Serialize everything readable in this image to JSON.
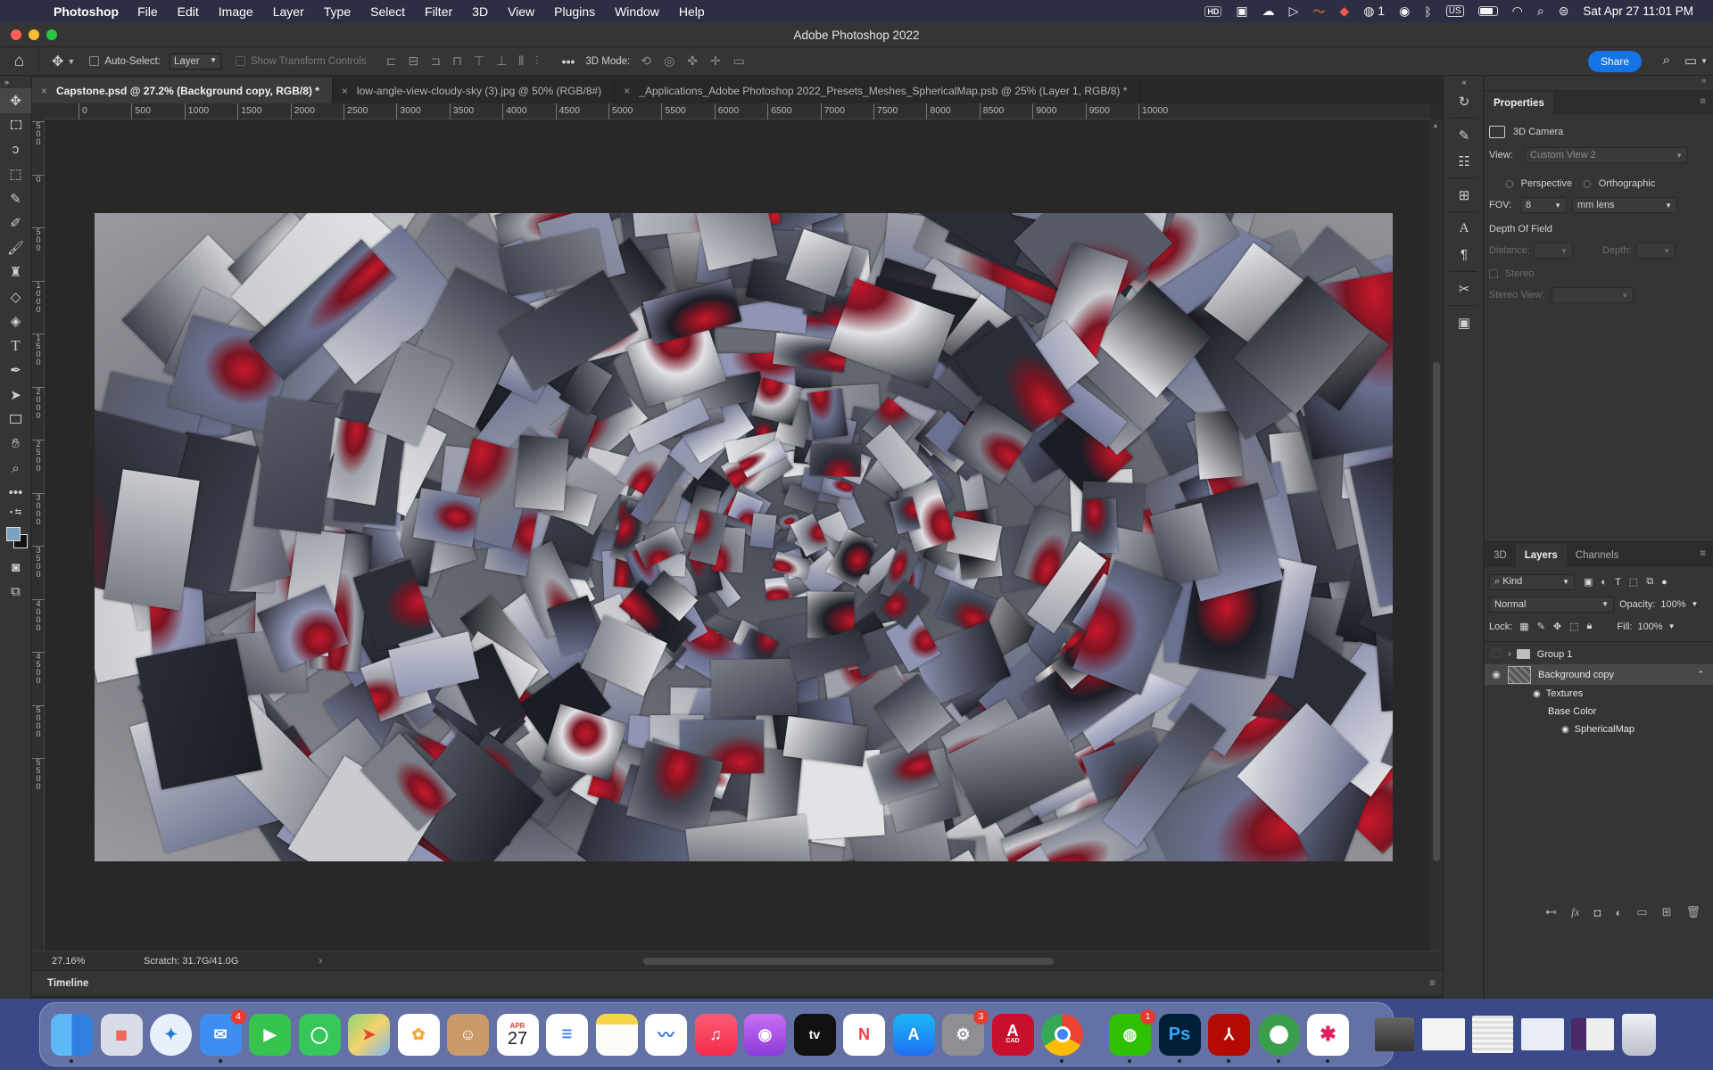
{
  "menubar": {
    "app_name": "Photoshop",
    "menus": [
      "File",
      "Edit",
      "Image",
      "Layer",
      "Type",
      "Select",
      "Filter",
      "3D",
      "View",
      "Plugins",
      "Window",
      "Help"
    ],
    "status_icons": [
      "hd-icon",
      "notes-icon",
      "creative-cloud-icon",
      "play-icon",
      "swoosh-icon",
      "adobe-notifications-icon",
      "wechat-status-icon",
      "globe-icon",
      "bluetooth-icon",
      "battery-icon",
      "wifi-icon",
      "spotlight-search-icon",
      "control-center-icon"
    ],
    "wechat_count": "1",
    "input_source": "US",
    "clock": "Sat Apr 27  11:01 PM"
  },
  "window": {
    "title": "Adobe Photoshop 2022"
  },
  "options_bar": {
    "auto_select_label": "Auto-Select:",
    "auto_select_target": "Layer",
    "show_transform_label": "Show Transform Controls",
    "mode_3d_label": "3D Mode:",
    "share_label": "Share"
  },
  "tabs": [
    {
      "label": "Capstone.psd @ 27.2% (Background copy, RGB/8) *",
      "active": true
    },
    {
      "label": "low-angle-view-cloudy-sky (3).jpg @ 50% (RGB/8#)",
      "active": false
    },
    {
      "label": "_Applications_Adobe Photoshop 2022_Presets_Meshes_SphericalMap.psb @ 25% (Layer 1, RGB/8) *",
      "active": false
    }
  ],
  "ruler": {
    "h_ticks": [
      "0",
      "500",
      "1000",
      "1500",
      "2000",
      "2500",
      "3000",
      "3500",
      "4000",
      "4500",
      "5000",
      "5500",
      "6000",
      "6500",
      "7000",
      "7500",
      "8000",
      "8500",
      "9000",
      "9500",
      "10000"
    ],
    "v_ticks": [
      "500",
      "0",
      "500",
      "1000",
      "1500",
      "2000",
      "2500",
      "3000",
      "3500",
      "4000",
      "4500",
      "5000",
      "5500"
    ]
  },
  "status": {
    "zoom": "27.16%",
    "scratch": "Scratch: 31.7G/41.0G",
    "arrow": "›"
  },
  "timeline": {
    "label": "Timeline"
  },
  "properties": {
    "header": "Properties",
    "section": "3D Camera",
    "view_label": "View:",
    "view_value": "Custom View 2",
    "perspective": "Perspective",
    "orthographic": "Orthographic",
    "fov_label": "FOV:",
    "fov_value": "8",
    "fov_unit": "mm lens",
    "dof_label": "Depth Of Field",
    "distance_label": "Distance:",
    "depth_label": "Depth:",
    "stereo_label": "Stereo",
    "stereo_view_label": "Stereo View:"
  },
  "layers_panel": {
    "tabs": [
      "3D",
      "Layers",
      "Channels"
    ],
    "kind_label": "Kind",
    "blend_mode": "Normal",
    "opacity_label": "Opacity:",
    "opacity_value": "100%",
    "lock_label": "Lock:",
    "fill_label": "Fill:",
    "fill_value": "100%",
    "items": {
      "group": "Group 1",
      "background_copy": "Background copy",
      "textures": "Textures",
      "base_color": "Base Color",
      "spherical_map": "SphericalMap"
    }
  },
  "dock": {
    "mail_badge": "4",
    "calendar_month": "APR",
    "calendar_day": "27",
    "settings_badge": "3",
    "autocad_label": "CAD",
    "wechat_badge": "1",
    "ps_label": "Ps"
  },
  "colors": {
    "menubar": "#2c2f43",
    "panel": "#353535",
    "canvas_bg": "#282828",
    "accent_blue": "#1473e6",
    "dock_bg": "#3a4a89",
    "artwork_red": "#c8182c"
  }
}
